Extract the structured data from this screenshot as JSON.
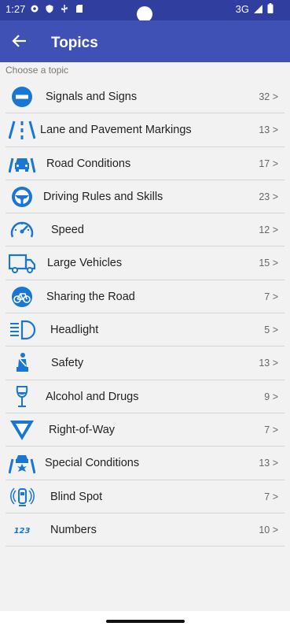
{
  "status": {
    "time": "1:27",
    "network": "3G"
  },
  "appbar": {
    "title": "Topics"
  },
  "subtitle": "Choose a topic",
  "topics": [
    {
      "label": "Signals and Signs",
      "count": "32 >",
      "icon": "no-entry-icon"
    },
    {
      "label": "Lane and Pavement Markings",
      "count": "13 >",
      "icon": "lane-markings-icon"
    },
    {
      "label": "Road Conditions",
      "count": "17 >",
      "icon": "car-road-icon"
    },
    {
      "label": "Driving Rules and Skills",
      "count": "23 >",
      "icon": "steering-wheel-icon"
    },
    {
      "label": "Speed",
      "count": "12 >",
      "icon": "speedometer-icon"
    },
    {
      "label": "Large Vehicles",
      "count": "15 >",
      "icon": "truck-icon"
    },
    {
      "label": "Sharing the Road",
      "count": "7 >",
      "icon": "bicycle-icon"
    },
    {
      "label": "Headlight",
      "count": "5 >",
      "icon": "headlight-icon"
    },
    {
      "label": "Safety",
      "count": "13 >",
      "icon": "seatbelt-icon"
    },
    {
      "label": "Alcohol and Drugs",
      "count": "9 >",
      "icon": "wine-glass-icon"
    },
    {
      "label": "Right-of-Way",
      "count": "7 >",
      "icon": "yield-sign-icon"
    },
    {
      "label": "Special Conditions",
      "count": "13 >",
      "icon": "car-crash-icon"
    },
    {
      "label": "Blind Spot",
      "count": "7 >",
      "icon": "blind-spot-icon"
    },
    {
      "label": "Numbers",
      "count": "10 >",
      "icon": "numbers-icon"
    }
  ],
  "colors": {
    "primary": "#3f51b5",
    "status": "#303f9f",
    "icon": "#1976d2"
  }
}
